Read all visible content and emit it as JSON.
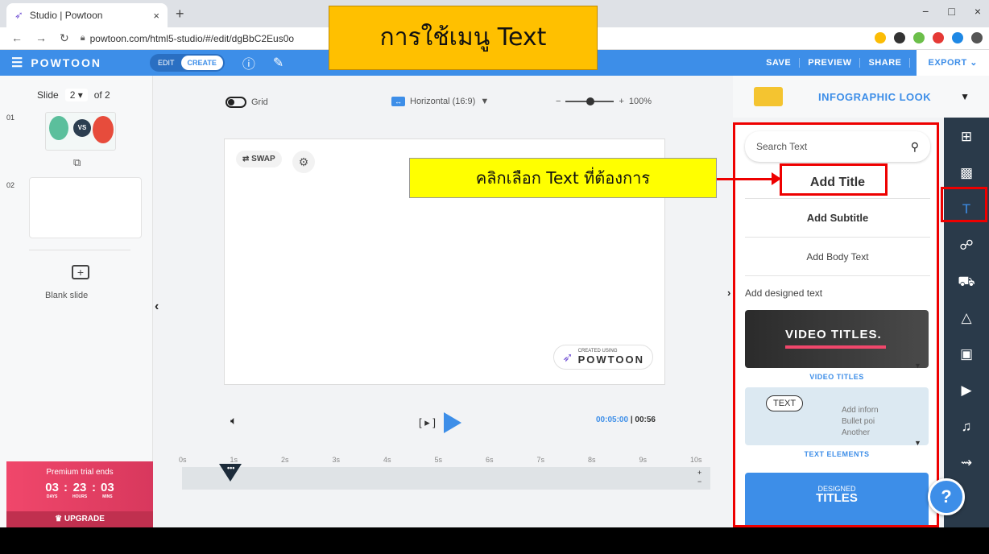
{
  "browser": {
    "tab_title": "Studio | Powtoon",
    "tab_close": "×",
    "new_tab": "+",
    "url": "powtoon.com/html5-studio/#/edit/dgBbC2Eus0o",
    "window_controls": [
      "−",
      "□",
      "×"
    ]
  },
  "overlay": {
    "title": "การใช้เมนู Text",
    "callout": "คลิกเลือก Text ที่ต้องการ",
    "highlight_color": "#e00000",
    "title_bg": "#ffc000",
    "callout_bg": "#ffff00"
  },
  "header": {
    "logo": "POWTOON",
    "mode_edit": "EDIT",
    "mode_create": "CREATE",
    "save": "SAVE",
    "preview": "PREVIEW",
    "share": "SHARE",
    "export": "EXPORT",
    "export_caret": "⌄",
    "accent": "#3d8ee8"
  },
  "slides": {
    "label": "Slide",
    "current": "2 ▾",
    "of": "of 2",
    "nums": [
      "01",
      "02"
    ],
    "thumb1_vs": "VS",
    "blank_slide": "Blank slide"
  },
  "premium": {
    "title": "Premium trial ends",
    "days": "03",
    "hours": "23",
    "mins": "03",
    "days_label": "DAYS",
    "hours_label": "HOURS",
    "mins_label": "MINS",
    "upgrade": "UPGRADE",
    "colors": [
      "#f0476b",
      "#c0304f"
    ]
  },
  "canvas": {
    "grid_label": "Grid",
    "ratio": "Horizontal (16:9)",
    "zoom_minus": "−",
    "zoom_plus": "+",
    "zoom": "100%",
    "swap": "SWAP",
    "watermark_small": "CREATED USING",
    "watermark_big": "POWTOON"
  },
  "playback": {
    "bracket_play": "[ ▸ ]",
    "current_time": "00:05:00",
    "separator": "|",
    "total_time": "00:56",
    "playhead_dots": "•••",
    "tick_labels": [
      "0s",
      "1s",
      "2s",
      "3s",
      "4s",
      "5s",
      "6s",
      "7s",
      "8s",
      "9s",
      "10s"
    ],
    "tl_zoom": [
      "+",
      "−"
    ]
  },
  "text_panel": {
    "look_label": "INFOGRAPHIC LOOK",
    "search_placeholder": "Search Text",
    "add_title": "Add Title",
    "add_subtitle": "Add Subtitle",
    "add_body": "Add Body Text",
    "designed_label": "Add designed text",
    "card_video_text": "VIDEO TITLES.",
    "card_video_caption": "VIDEO TITLES",
    "card_text_bubble": "TEXT",
    "card_text_lines": [
      "Add inforn",
      "Bullet poi",
      "Another"
    ],
    "card_text_caption": "TEXT ELEMENTS",
    "card_design_small": "DESIGNED",
    "card_design_big": "TITLES"
  },
  "rail": {
    "icons": [
      {
        "name": "layout-icon",
        "glyph": "⊞"
      },
      {
        "name": "background-icon",
        "glyph": "▩"
      },
      {
        "name": "text-icon",
        "glyph": "T",
        "active": true
      },
      {
        "name": "characters-icon",
        "glyph": "☍"
      },
      {
        "name": "props-icon",
        "glyph": "⛟"
      },
      {
        "name": "shapes-icon",
        "glyph": "△"
      },
      {
        "name": "images-icon",
        "glyph": "▣"
      },
      {
        "name": "video-icon",
        "glyph": "▶"
      },
      {
        "name": "music-icon",
        "glyph": "♫"
      },
      {
        "name": "transitions-icon",
        "glyph": "⇝"
      }
    ],
    "help": "?"
  }
}
